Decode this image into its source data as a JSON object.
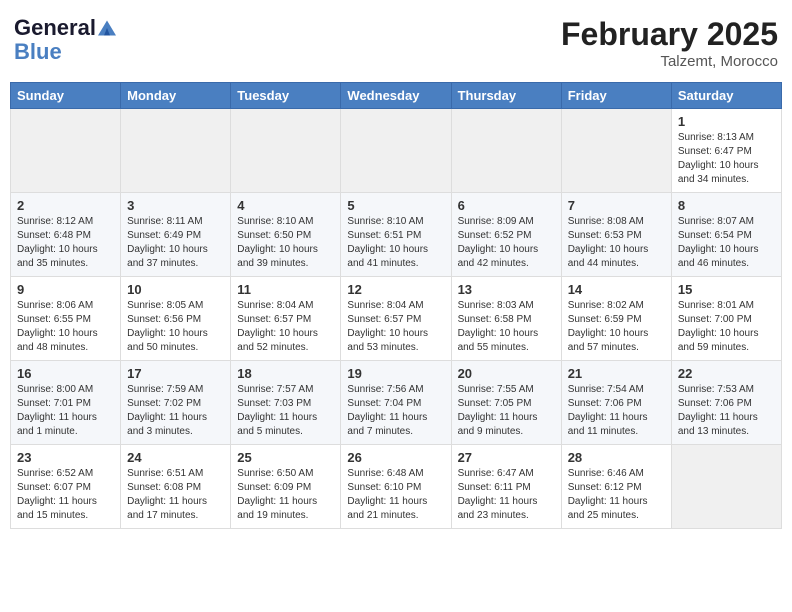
{
  "header": {
    "logo_line1": "General",
    "logo_line2": "Blue",
    "month_year": "February 2025",
    "location": "Talzemt, Morocco"
  },
  "weekdays": [
    "Sunday",
    "Monday",
    "Tuesday",
    "Wednesday",
    "Thursday",
    "Friday",
    "Saturday"
  ],
  "weeks": [
    [
      {
        "day": "",
        "info": ""
      },
      {
        "day": "",
        "info": ""
      },
      {
        "day": "",
        "info": ""
      },
      {
        "day": "",
        "info": ""
      },
      {
        "day": "",
        "info": ""
      },
      {
        "day": "",
        "info": ""
      },
      {
        "day": "1",
        "info": "Sunrise: 8:13 AM\nSunset: 6:47 PM\nDaylight: 10 hours and 34 minutes."
      }
    ],
    [
      {
        "day": "2",
        "info": "Sunrise: 8:12 AM\nSunset: 6:48 PM\nDaylight: 10 hours and 35 minutes."
      },
      {
        "day": "3",
        "info": "Sunrise: 8:11 AM\nSunset: 6:49 PM\nDaylight: 10 hours and 37 minutes."
      },
      {
        "day": "4",
        "info": "Sunrise: 8:10 AM\nSunset: 6:50 PM\nDaylight: 10 hours and 39 minutes."
      },
      {
        "day": "5",
        "info": "Sunrise: 8:10 AM\nSunset: 6:51 PM\nDaylight: 10 hours and 41 minutes."
      },
      {
        "day": "6",
        "info": "Sunrise: 8:09 AM\nSunset: 6:52 PM\nDaylight: 10 hours and 42 minutes."
      },
      {
        "day": "7",
        "info": "Sunrise: 8:08 AM\nSunset: 6:53 PM\nDaylight: 10 hours and 44 minutes."
      },
      {
        "day": "8",
        "info": "Sunrise: 8:07 AM\nSunset: 6:54 PM\nDaylight: 10 hours and 46 minutes."
      }
    ],
    [
      {
        "day": "9",
        "info": "Sunrise: 8:06 AM\nSunset: 6:55 PM\nDaylight: 10 hours and 48 minutes."
      },
      {
        "day": "10",
        "info": "Sunrise: 8:05 AM\nSunset: 6:56 PM\nDaylight: 10 hours and 50 minutes."
      },
      {
        "day": "11",
        "info": "Sunrise: 8:04 AM\nSunset: 6:57 PM\nDaylight: 10 hours and 52 minutes."
      },
      {
        "day": "12",
        "info": "Sunrise: 8:04 AM\nSunset: 6:57 PM\nDaylight: 10 hours and 53 minutes."
      },
      {
        "day": "13",
        "info": "Sunrise: 8:03 AM\nSunset: 6:58 PM\nDaylight: 10 hours and 55 minutes."
      },
      {
        "day": "14",
        "info": "Sunrise: 8:02 AM\nSunset: 6:59 PM\nDaylight: 10 hours and 57 minutes."
      },
      {
        "day": "15",
        "info": "Sunrise: 8:01 AM\nSunset: 7:00 PM\nDaylight: 10 hours and 59 minutes."
      }
    ],
    [
      {
        "day": "16",
        "info": "Sunrise: 8:00 AM\nSunset: 7:01 PM\nDaylight: 11 hours and 1 minute."
      },
      {
        "day": "17",
        "info": "Sunrise: 7:59 AM\nSunset: 7:02 PM\nDaylight: 11 hours and 3 minutes."
      },
      {
        "day": "18",
        "info": "Sunrise: 7:57 AM\nSunset: 7:03 PM\nDaylight: 11 hours and 5 minutes."
      },
      {
        "day": "19",
        "info": "Sunrise: 7:56 AM\nSunset: 7:04 PM\nDaylight: 11 hours and 7 minutes."
      },
      {
        "day": "20",
        "info": "Sunrise: 7:55 AM\nSunset: 7:05 PM\nDaylight: 11 hours and 9 minutes."
      },
      {
        "day": "21",
        "info": "Sunrise: 7:54 AM\nSunset: 7:06 PM\nDaylight: 11 hours and 11 minutes."
      },
      {
        "day": "22",
        "info": "Sunrise: 7:53 AM\nSunset: 7:06 PM\nDaylight: 11 hours and 13 minutes."
      }
    ],
    [
      {
        "day": "23",
        "info": "Sunrise: 6:52 AM\nSunset: 6:07 PM\nDaylight: 11 hours and 15 minutes."
      },
      {
        "day": "24",
        "info": "Sunrise: 6:51 AM\nSunset: 6:08 PM\nDaylight: 11 hours and 17 minutes."
      },
      {
        "day": "25",
        "info": "Sunrise: 6:50 AM\nSunset: 6:09 PM\nDaylight: 11 hours and 19 minutes."
      },
      {
        "day": "26",
        "info": "Sunrise: 6:48 AM\nSunset: 6:10 PM\nDaylight: 11 hours and 21 minutes."
      },
      {
        "day": "27",
        "info": "Sunrise: 6:47 AM\nSunset: 6:11 PM\nDaylight: 11 hours and 23 minutes."
      },
      {
        "day": "28",
        "info": "Sunrise: 6:46 AM\nSunset: 6:12 PM\nDaylight: 11 hours and 25 minutes."
      },
      {
        "day": "",
        "info": ""
      }
    ]
  ]
}
